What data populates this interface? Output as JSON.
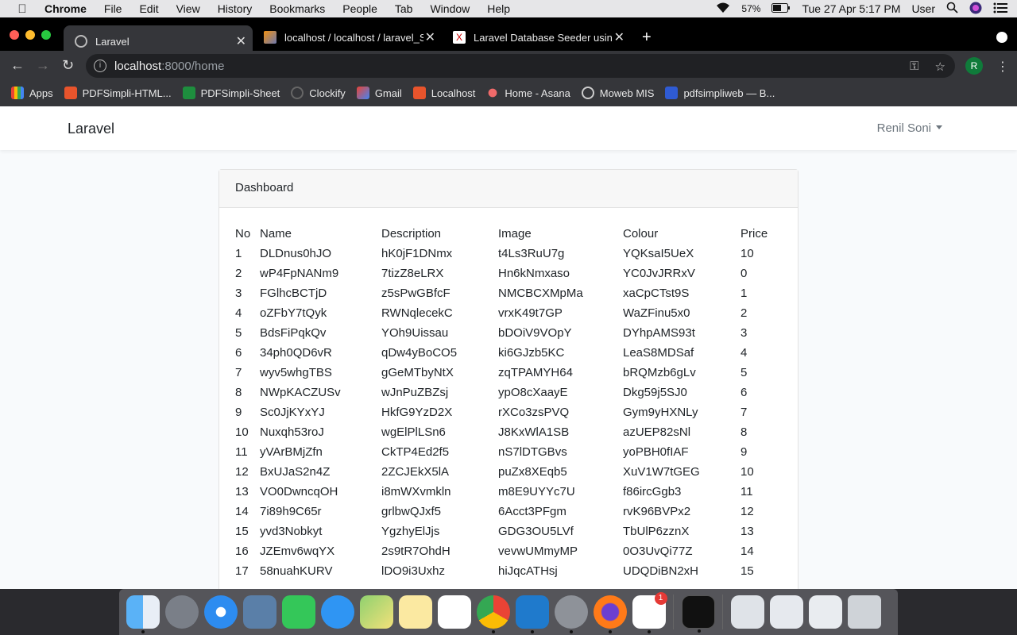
{
  "menubar": {
    "app": "Chrome",
    "items": [
      "File",
      "Edit",
      "View",
      "History",
      "Bookmarks",
      "People",
      "Tab",
      "Window",
      "Help"
    ],
    "battery": "57%",
    "datetime": "Tue 27 Apr  5:17 PM",
    "user": "User"
  },
  "tabs": [
    {
      "title": "Laravel",
      "active": true
    },
    {
      "title": "localhost / localhost / laravel_S",
      "active": false
    },
    {
      "title": "Laravel Database Seeder using",
      "active": false
    }
  ],
  "omnibox": {
    "host": "localhost",
    "path": ":8000/home"
  },
  "profile_initial": "R",
  "bookmarks": [
    "Apps",
    "PDFSimpli-HTML...",
    "PDFSimpli-Sheet",
    "Clockify",
    "Gmail",
    "Localhost",
    "Home - Asana",
    "Moweb MIS",
    "pdfsimpliweb — B..."
  ],
  "app": {
    "brand": "Laravel",
    "user": "Renil Soni"
  },
  "card": {
    "title": "Dashboard"
  },
  "table": {
    "headers": [
      "No",
      "Name",
      "Description",
      "Image",
      "Colour",
      "Price"
    ],
    "rows": [
      [
        "1",
        "DLDnus0hJO",
        "hK0jF1DNmx",
        "t4Ls3RuU7g",
        "YQKsaI5UeX",
        "10"
      ],
      [
        "2",
        "wP4FpNANm9",
        "7tizZ8eLRX",
        "Hn6kNmxaso",
        "YC0JvJRRxV",
        "0"
      ],
      [
        "3",
        "FGlhcBCTjD",
        "z5sPwGBfcF",
        "NMCBCXMpMa",
        "xaCpCTst9S",
        "1"
      ],
      [
        "4",
        "oZFbY7tQyk",
        "RWNqlecekC",
        "vrxK49t7GP",
        "WaZFinu5x0",
        "2"
      ],
      [
        "5",
        "BdsFiPqkQv",
        "YOh9Uissau",
        "bDOiV9VOpY",
        "DYhpAMS93t",
        "3"
      ],
      [
        "6",
        "34ph0QD6vR",
        "qDw4yBoCO5",
        "ki6GJzb5KC",
        "LeaS8MDSaf",
        "4"
      ],
      [
        "7",
        "wyv5whgTBS",
        "gGeMTbyNtX",
        "zqTPAMYH64",
        "bRQMzb6gLv",
        "5"
      ],
      [
        "8",
        "NWpKACZUSv",
        "wJnPuZBZsj",
        "ypO8cXaayE",
        "Dkg59j5SJ0",
        "6"
      ],
      [
        "9",
        "Sc0JjKYxYJ",
        "HkfG9YzD2X",
        "rXCo3zsPVQ",
        "Gym9yHXNLy",
        "7"
      ],
      [
        "10",
        "Nuxqh53roJ",
        "wgElPlLSn6",
        "J8KxWlA1SB",
        "azUEP82sNl",
        "8"
      ],
      [
        "11",
        "yVArBMjZfn",
        "CkTP4Ed2f5",
        "nS7lDTGBvs",
        "yoPBH0fIAF",
        "9"
      ],
      [
        "12",
        "BxUJaS2n4Z",
        "2ZCJEkX5lA",
        "puZx8XEqb5",
        "XuV1W7tGEG",
        "10"
      ],
      [
        "13",
        "VO0DwncqOH",
        "i8mWXvmkln",
        "m8E9UYYc7U",
        "f86ircGgb3",
        "11"
      ],
      [
        "14",
        "7i89h9C65r",
        "grlbwQJxf5",
        "6Acct3PFgm",
        "rvK96BVPx2",
        "12"
      ],
      [
        "15",
        "yvd3Nobkyt",
        "YgzhyElJjs",
        "GDG3OU5LVf",
        "TbUlP6zznX",
        "13"
      ],
      [
        "16",
        "JZEmv6wqYX",
        "2s9tR7OhdH",
        "vevwUMmyMP",
        "0O3UvQi77Z",
        "14"
      ],
      [
        "17",
        "58nuahKURV",
        "lDO9i3Uxhz",
        "hiJqcATHsj",
        "UDQDiBN2xH",
        "15"
      ]
    ]
  },
  "dock_badge": "1"
}
